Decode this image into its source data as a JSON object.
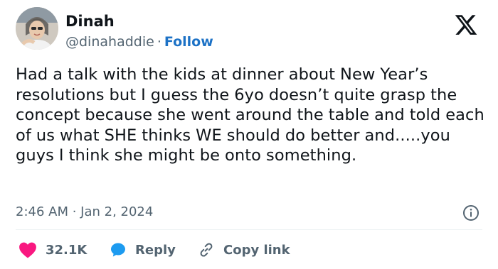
{
  "author": {
    "name": "Dinah",
    "handle": "@dinahaddie",
    "separator": "·",
    "follow_label": "Follow"
  },
  "platform": {
    "logo_icon": "x-logo-icon"
  },
  "tweet": {
    "text": "Had a talk with the kids at dinner about New Year’s resolutions but I guess the 6yo doesn’t quite grasp the concept because she went around the table and told each of us what SHE thinks WE should do better and.....you guys I think she might be onto something.",
    "timestamp": "2:46 AM · Jan 2, 2024"
  },
  "actions": {
    "likes_count": "32.1K",
    "reply_label": "Reply",
    "copy_link_label": "Copy link"
  },
  "icons": {
    "like": "heart-icon",
    "reply": "speech-bubble-icon",
    "copy": "link-icon",
    "info": "info-icon"
  },
  "colors": {
    "text": "#0f1419",
    "secondary_text": "#536471",
    "follow": "#1d72c6",
    "like": "#f91880",
    "reply": "#1d9bf0",
    "divider": "#eff3f4"
  }
}
